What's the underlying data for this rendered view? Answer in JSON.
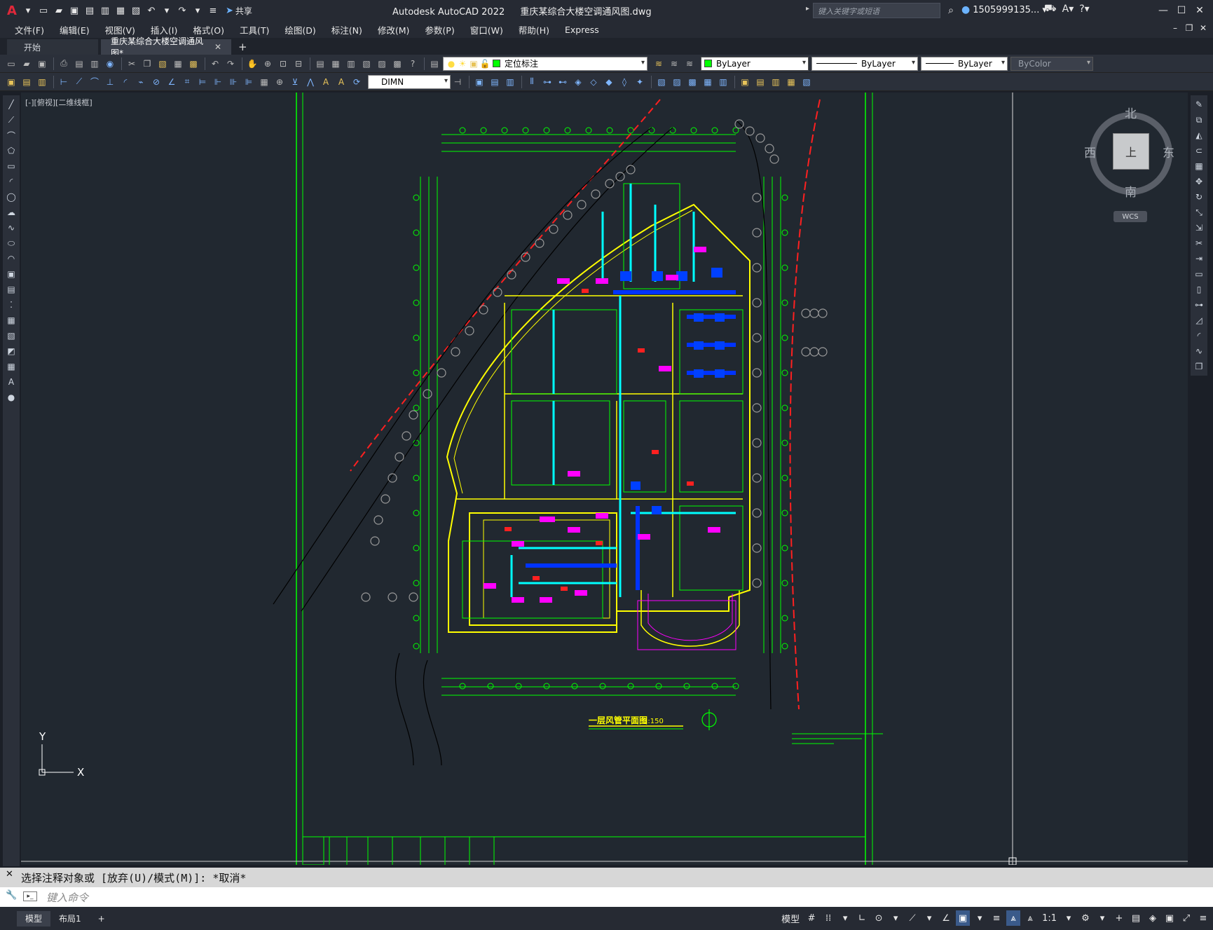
{
  "window": {
    "app_title": "Autodesk AutoCAD 2022",
    "file_title": "重庆某综合大楼空调通风图.dwg",
    "share_label": "共享",
    "search_placeholder": "键入关键字或短语",
    "user_name": "1505999135..."
  },
  "menu": {
    "items": [
      "文件(F)",
      "编辑(E)",
      "视图(V)",
      "插入(I)",
      "格式(O)",
      "工具(T)",
      "绘图(D)",
      "标注(N)",
      "修改(M)",
      "参数(P)",
      "窗口(W)",
      "帮助(H)",
      "Express"
    ]
  },
  "doc_tabs": {
    "start": "开始",
    "active": "重庆某综合大楼空调通风图*"
  },
  "toolbar": {
    "layer_name": "定位标注",
    "color": "ByLayer",
    "linetype": "ByLayer",
    "lineweight": "ByLayer",
    "plotstyle": "ByColor",
    "dimstyle": "DIMN"
  },
  "viewport": {
    "label": "[-][俯视][二维线框]"
  },
  "viewcube": {
    "north": "北",
    "south": "南",
    "east": "东",
    "west": "西",
    "face": "上",
    "wcs": "WCS"
  },
  "drawing": {
    "title": "一层风管平面图",
    "scale": "1:150",
    "ucs_x": "X",
    "ucs_y": "Y"
  },
  "command": {
    "history": "选择注释对象或 [放弃(U)/模式(M)]: *取消*",
    "placeholder": "键入命令"
  },
  "layout_tabs": [
    "模型",
    "布局1"
  ],
  "statusbar": {
    "model_label": "模型",
    "scale": "1:1"
  },
  "colors": {
    "background": "#212830",
    "green": "#00ff00",
    "yellow": "#ffff00",
    "cyan": "#00ffff",
    "blue": "#0000ff",
    "magenta": "#ff00ff",
    "red": "#ff0000"
  }
}
